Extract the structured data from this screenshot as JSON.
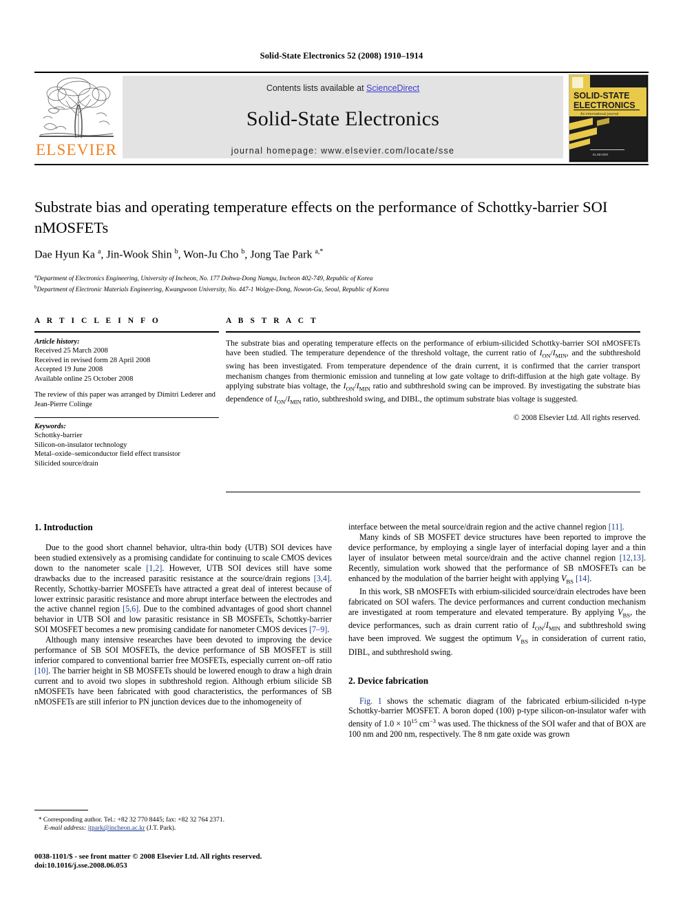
{
  "running_head": "Solid-State Electronics 52 (2008) 1910–1914",
  "banner": {
    "contents_prefix": "Contents lists available at ",
    "sciencedirect": "ScienceDirect",
    "journal_title": "Solid-State Electronics",
    "homepage": "journal homepage: www.elsevier.com/locate/sse",
    "publisher_wordmark": "ELSEVIER",
    "cover_title_line1": "SOLID-STATE",
    "cover_title_line2": "ELECTRONICS",
    "cover_subtitle": "An international journal",
    "cover_publisher": "ELSEVIER",
    "link_color": "#3a3ad0",
    "wordmark_color": "#F08222",
    "band_color": "#e3e3e3"
  },
  "article": {
    "title": "Substrate bias and operating temperature effects on the performance of Schottky-barrier SOI nMOSFETs",
    "authors_html": "Dae Hyun Ka <sup>a</sup>, Jin-Wook Shin <sup>b</sup>, Won-Ju Cho <sup>b</sup>, Jong Tae Park <sup>a,*</sup>",
    "affiliation_a": "Department of Electronics Engineering, University of Incheon, No. 177 Dohwa-Dong Namgu, Incheon 402-749, Republic of Korea",
    "affiliation_b": "Department of Electronic Materials Engineering, Kwangwoon University, No. 447-1 Wolgye-Dong, Nowon-Gu, Seoul, Republic of Korea"
  },
  "article_info": {
    "heading": "A R T I C L E    I N F O",
    "history_label": "Article history:",
    "history": [
      "Received 25 March 2008",
      "Received in revised form 28 April 2008",
      "Accepted 19 June 2008",
      "Available online 25 October 2008"
    ],
    "review_note": "The review of this paper was arranged by Dimitri Lederer and Jean-Pierre Colinge",
    "keywords_label": "Keywords:",
    "keywords": [
      "Schottky-barrier",
      "Silicon-on-insulator technology",
      "Metal–oxide–semiconductor field effect transistor",
      "Silicided source/drain"
    ]
  },
  "abstract": {
    "heading": "A B S T R A C T",
    "text_html": "The substrate bias and operating temperature effects on the performance of erbium-silicided Schottky-barrier SOI nMOSFETs have been studied. The temperature dependence of the threshold voltage, the current ratio of <i>I</i><sub>ON</sub>/<i>I</i><sub>MIN</sub>, and the subthreshold swing has been investigated. From temperature dependence of the drain current, it is confirmed that the carrier transport mechanism changes from thermionic emission and tunneling at low gate voltage to drift-diffusion at the high gate voltage. By applying substrate bias voltage, the <i>I</i><sub>ON</sub>/<i>I</i><sub>MIN</sub> ratio and subthreshold swing can be improved. By investigating the substrate bias dependence of <i>I</i><sub>ON</sub>/<i>I</i><sub>MIN</sub> ratio, subthreshold swing, and DIBL, the optimum substrate bias voltage is suggested.",
    "copyright": "© 2008 Elsevier Ltd. All rights reserved."
  },
  "body": {
    "section1_heading": "1. Introduction",
    "section2_heading": "2. Device fabrication",
    "left_paragraphs_html": [
      "Due to the good short channel behavior, ultra-thin body (UTB) SOI devices have been studied extensively as a promising candidate for continuing to scale CMOS devices down to the nanometer scale <span class=\"ref\">[1,2]</span>. However, UTB SOI devices still have some drawbacks due to the increased parasitic resistance at the source/drain regions <span class=\"ref\">[3,4]</span>. Recently, Schottky-barrier MOSFETs have attracted a great deal of interest because of lower extrinsic parasitic resistance and more abrupt interface between the electrodes and the active channel region <span class=\"ref\">[5,6]</span>. Due to the combined advantages of good short channel behavior in UTB SOI and low parasitic resistance in SB MOSFETs, Schottky-barrier SOI MOSFET becomes a new promising candidate for nanometer CMOS devices <span class=\"ref\">[7–9]</span>.",
      "Although many intensive researches have been devoted to improving the device performance of SB SOI MOSFETs, the device performance of SB MOSFET is still inferior compared to conventional barrier free MOSFETs, especially current on–off ratio <span class=\"ref\">[10]</span>. The barrier height in SB MOSFETs should be lowered enough to draw a high drain current and to avoid two slopes in subthreshold region. Although erbium silicide SB nMOSFETs have been fabricated with good characteristics, the performances of SB nMOSFETs are still inferior to PN junction devices due to the inhomogeneity of"
    ],
    "right_paragraphs_html": [
      "interface between the metal source/drain region and the active channel region <span class=\"ref\">[11]</span>.",
      "Many kinds of SB MOSFET device structures have been reported to improve the device performance, by employing a single layer of interfacial doping layer and a thin layer of insulator between metal source/drain and the active channel region <span class=\"ref\">[12,13]</span>. Recently, simulation work showed that the performance of SB nMOSFETs can be enhanced by the modulation of the barrier height with applying <i>V</i><sub>BS</sub> <span class=\"ref\">[14]</span>.",
      "In this work, SB nMOSFETs with erbium-silicided source/drain electrodes have been fabricated on SOI wafers. The device performances and current conduction mechanism are investigated at room temperature and elevated temperature. By applying <i>V</i><sub>BS</sub>, the device performances, such as drain current ratio of <i>I</i><sub>ON</sub>/<i>I</i><sub>MIN</sub> and subthreshold swing have been improved. We suggest the optimum <i>V</i><sub>BS</sub> in consideration of current ratio, DIBL, and subthreshold swing."
    ],
    "section2_paragraph_html": "<span class=\"ref\">Fig. 1</span> shows the schematic diagram of the fabricated erbium-silicided n-type Schottky-barrier MOSFET. A boron doped (100) p-type silicon-on-insulator wafer with density of 1.0 × 10<sup>15</sup> cm<sup>−3</sup> was used. The thickness of the SOI wafer and that of BOX are 100 nm and 200 nm, respectively. The 8 nm gate oxide was grown"
  },
  "footer": {
    "corresponding_html": "<span class=\"star\">*</span> Corresponding author. Tel.: +82 32 770 8445; fax: +82 32 764 2371.",
    "email_label": "E-mail address:",
    "email": "jtpark@incheon.ac.kr",
    "email_suffix": "(J.T. Park).",
    "issn_line": "0038-1101/$ - see front matter © 2008 Elsevier Ltd. All rights reserved.",
    "doi_line": "doi:10.1016/j.sse.2008.06.053"
  }
}
